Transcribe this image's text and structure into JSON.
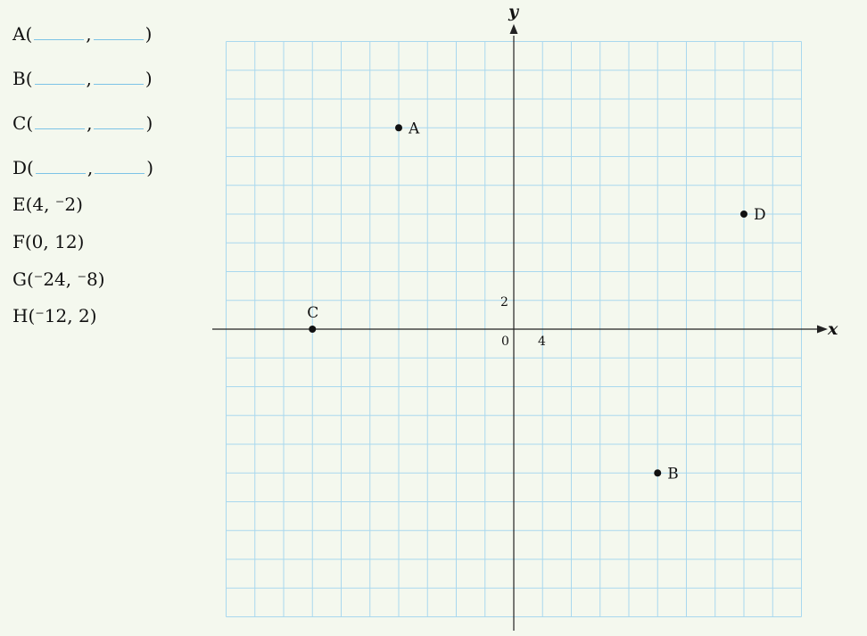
{
  "points_to_find": [
    {
      "name": "A",
      "open": "(",
      "sep": ",",
      "close": ")"
    },
    {
      "name": "B",
      "open": "(",
      "sep": ",",
      "close": ")"
    },
    {
      "name": "C",
      "open": "(",
      "sep": ",",
      "close": ")"
    },
    {
      "name": "D",
      "open": "(",
      "sep": ",",
      "close": ")"
    }
  ],
  "given_points": [
    {
      "text": "E(4, ⁻2)"
    },
    {
      "text": "F(0, 12)"
    },
    {
      "text": "G(⁻24, ⁻8)"
    },
    {
      "text": "H(⁻12, 2)"
    }
  ],
  "axes": {
    "x_label": "x",
    "y_label": "y",
    "origin_label": "0",
    "x_tick_label": "4",
    "y_tick_label": "2",
    "x_step": 4,
    "y_step": 2,
    "x_range": [
      -40,
      40
    ],
    "y_range": [
      -20,
      20
    ]
  },
  "plotted_points": [
    {
      "label": "A",
      "x": -16,
      "y": 14
    },
    {
      "label": "B",
      "x": 20,
      "y": -10
    },
    {
      "label": "C",
      "x": -28,
      "y": 0
    },
    {
      "label": "D",
      "x": 32,
      "y": 8
    }
  ],
  "colors": {
    "grid": "#a9d8ee",
    "axis": "#222222",
    "point": "#111111",
    "background": "#f4f8ee"
  }
}
